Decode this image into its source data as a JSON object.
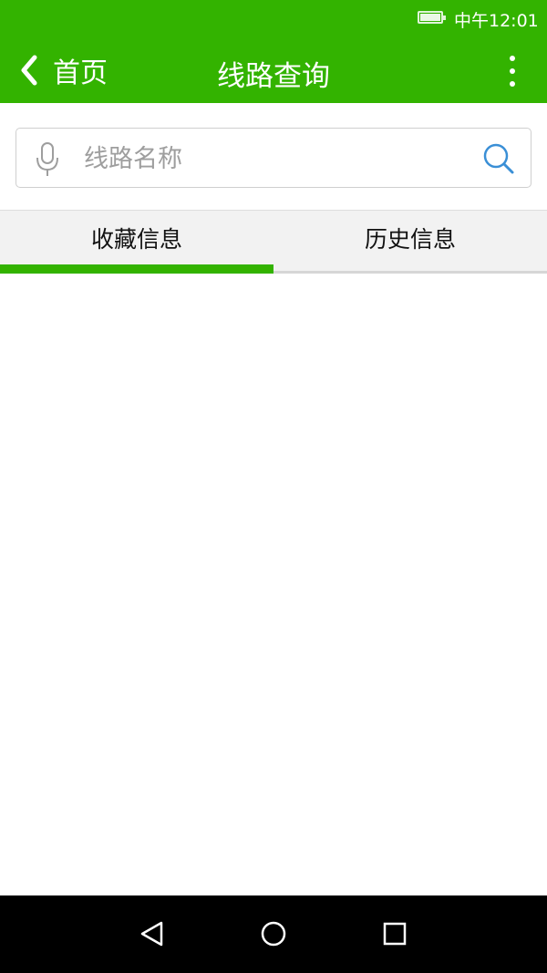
{
  "status_bar": {
    "time": "中午12:01",
    "battery_icon": "battery-full-icon"
  },
  "toolbar": {
    "back_label": "首页",
    "back_icon": "chevron-left-icon",
    "title": "线路查询",
    "more_icon": "more-vertical-icon"
  },
  "search": {
    "placeholder": "线路名称",
    "value": "",
    "mic_icon": "microphone-icon",
    "search_icon": "search-icon"
  },
  "tabs": [
    {
      "label": "收藏信息",
      "active": true
    },
    {
      "label": "历史信息",
      "active": false
    }
  ],
  "nav_bar": {
    "back_icon": "triangle-back-icon",
    "home_icon": "circle-home-icon",
    "recents_icon": "square-recents-icon"
  },
  "colors": {
    "accent": "#33b300",
    "search_icon": "#3a8fd6"
  }
}
